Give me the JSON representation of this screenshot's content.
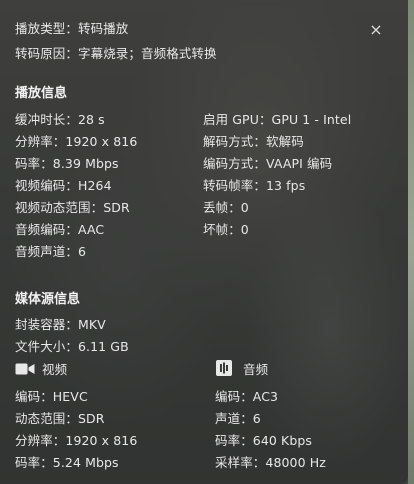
{
  "header": {
    "play_type": "播放类型：转码播放",
    "transcode_reason": "转码原因：字幕烧录；音频格式转换"
  },
  "close_glyph": "×",
  "playback": {
    "title": "播放信息",
    "left": [
      "缓冲时长：28 s",
      "分辨率：1920 x 816",
      "码率：8.39 Mbps",
      "视频编码：H264",
      "视频动态范围：SDR",
      "音频编码：AAC",
      "音频声道：6"
    ],
    "right": [
      "启用 GPU：GPU 1 - Intel",
      "解码方式：软解码",
      "编码方式：VAAPI 编码",
      "转码帧率：13 fps",
      "丢帧：0",
      "坏帧：0"
    ]
  },
  "media": {
    "title": "媒体源信息",
    "container": "封装容器：MKV",
    "file_size": "文件大小：6.11 GB",
    "video": {
      "label": "视频",
      "icon": "video-camera-icon",
      "rows": [
        "编码：HEVC",
        "动态范围：SDR",
        "分辨率：1920 x 816",
        "码率：5.24 Mbps"
      ]
    },
    "audio": {
      "label": "音频",
      "icon": "audio-icon",
      "rows": [
        "编码：AC3",
        "声道：6",
        "码率：640 Kbps",
        "采样率：48000 Hz"
      ]
    }
  }
}
